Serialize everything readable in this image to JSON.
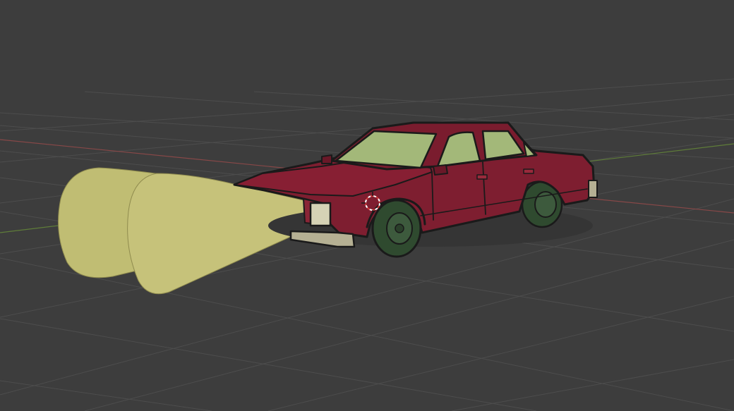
{
  "viewport": {
    "background": "#3d3d3d",
    "grid_color": "#4d4d4d",
    "x_axis_color": "#8c4a4a",
    "y_axis_color": "#6c8a3a",
    "grid_visible": true
  },
  "scene": {
    "objects": [
      {
        "name": "car",
        "body_color": "#7e1e30",
        "window_color": "#a3b879",
        "tire_color": "#2f4a2f",
        "bumper_color": "#b5b093",
        "outline_color": "#1a1a1a"
      },
      {
        "name": "headlight-cones",
        "color": "#c0bd73",
        "count": 2
      },
      {
        "name": "3d-cursor",
        "icon": "3d-cursor-icon",
        "colors": [
          "#ffffff",
          "#d23a3a"
        ]
      }
    ]
  }
}
